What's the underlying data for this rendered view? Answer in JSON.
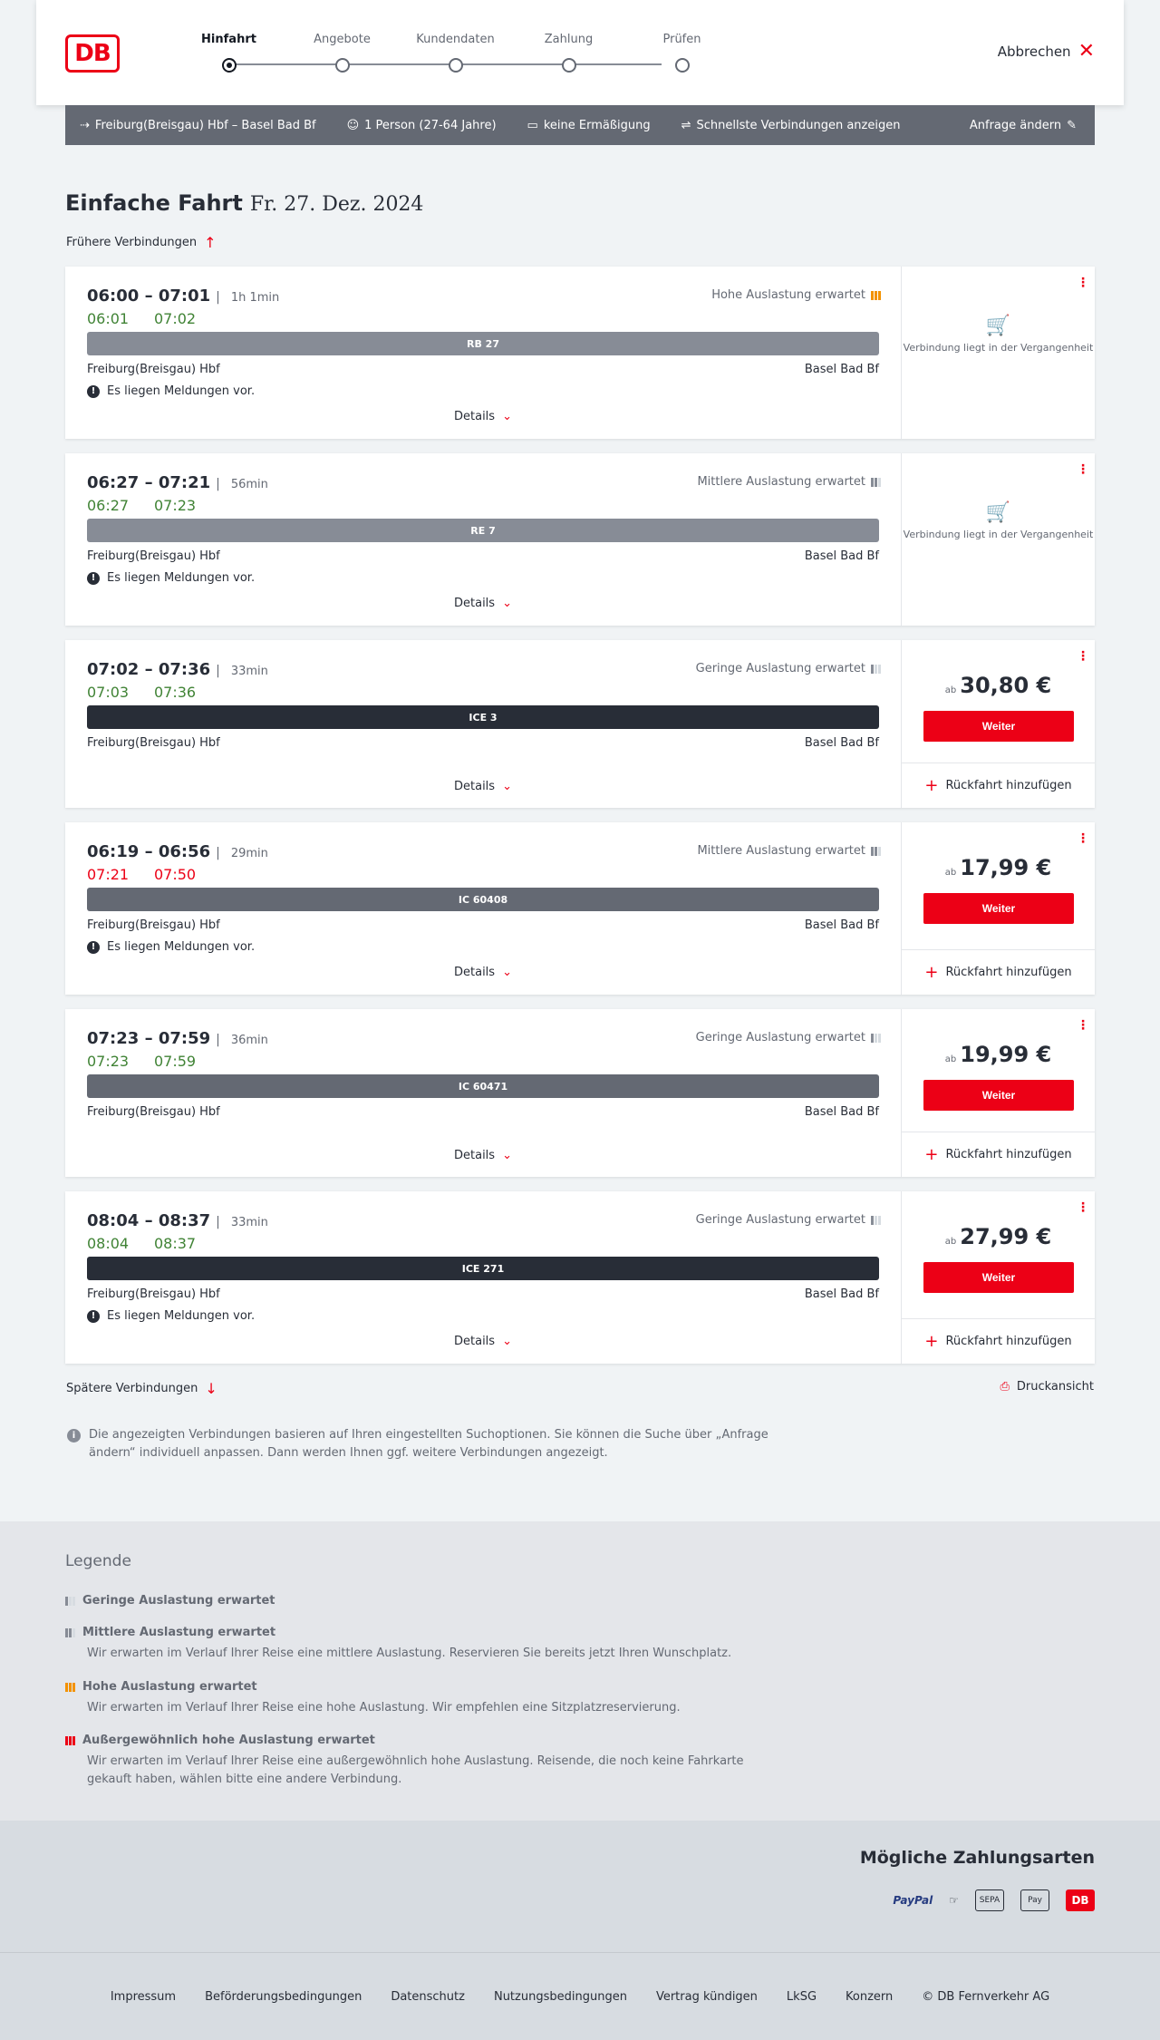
{
  "header": {
    "logo_text": "DB",
    "steps": [
      {
        "label": "Hinfahrt",
        "active": true
      },
      {
        "label": "Angebote",
        "active": false
      },
      {
        "label": "Kundendaten",
        "active": false
      },
      {
        "label": "Zahlung",
        "active": false
      },
      {
        "label": "Prüfen",
        "active": false
      }
    ],
    "cancel_label": "Abbrechen"
  },
  "query": {
    "route": "Freiburg(Breisgau) Hbf – Basel Bad Bf",
    "persons": "1 Person (27-64 Jahre)",
    "discount": "keine Ermäßigung",
    "fastest": "Schnellste Verbindungen anzeigen",
    "change": "Anfrage ändern"
  },
  "page": {
    "title": "Einfache Fahrt",
    "date": "Fr. 27. Dez. 2024",
    "earlier": "Frühere Verbindungen",
    "later": "Spätere Verbindungen",
    "print": "Druckansicht",
    "info": "Die angezeigten Verbindungen basieren auf Ihren eingestellten Suchoptionen. Sie können die Suche über „Anfrage ändern“ individuell anpassen. Dann werden Ihnen ggf. weitere Verbindungen angezeigt."
  },
  "labels": {
    "details": "Details",
    "weiter": "Weiter",
    "rueckfahrt": "Rückfahrt hinzufügen",
    "ab": "ab",
    "past": "Verbindung liegt in der Vergangenheit",
    "meldung": "Es liegen Meldungen vor.",
    "from": "Freiburg(Breisgau) Hbf",
    "to": "Basel Bad Bf"
  },
  "connections": [
    {
      "times": "06:00 – 07:01",
      "duration": "1h 1min",
      "rt_dep": "06:01",
      "rt_arr": "07:02",
      "rt_late": false,
      "load": "Hohe Auslastung erwartet",
      "load_level": 3,
      "train": "RB 27",
      "train_style": "light",
      "meldung": true,
      "past": true,
      "price": ""
    },
    {
      "times": "06:27 – 07:21",
      "duration": "56min",
      "rt_dep": "06:27",
      "rt_arr": "07:23",
      "rt_late": false,
      "load": "Mittlere Auslastung erwartet",
      "load_level": 2,
      "train": "RE 7",
      "train_style": "light",
      "meldung": true,
      "past": true,
      "price": ""
    },
    {
      "times": "07:02 – 07:36",
      "duration": "33min",
      "rt_dep": "07:03",
      "rt_arr": "07:36",
      "rt_late": false,
      "load": "Geringe Auslastung erwartet",
      "load_level": 1,
      "train": "ICE 3",
      "train_style": "dark",
      "meldung": false,
      "past": false,
      "price": "30,80 €"
    },
    {
      "times": "06:19 – 06:56",
      "duration": "29min",
      "rt_dep": "07:21",
      "rt_arr": "07:50",
      "rt_late": true,
      "load": "Mittlere Auslastung erwartet",
      "load_level": 2,
      "train": "IC 60408",
      "train_style": "mid",
      "meldung": true,
      "past": false,
      "price": "17,99 €"
    },
    {
      "times": "07:23 – 07:59",
      "duration": "36min",
      "rt_dep": "07:23",
      "rt_arr": "07:59",
      "rt_late": false,
      "load": "Geringe Auslastung erwartet",
      "load_level": 1,
      "train": "IC 60471",
      "train_style": "mid",
      "meldung": false,
      "past": false,
      "price": "19,99 €"
    },
    {
      "times": "08:04 – 08:37",
      "duration": "33min",
      "rt_dep": "08:04",
      "rt_arr": "08:37",
      "rt_late": false,
      "load": "Geringe Auslastung erwartet",
      "load_level": 1,
      "train": "ICE 271",
      "train_style": "dark",
      "meldung": true,
      "past": false,
      "price": "27,99 €"
    }
  ],
  "legend": {
    "title": "Legende",
    "items": [
      {
        "title": "Geringe Auslastung erwartet",
        "desc": "",
        "level": 1
      },
      {
        "title": "Mittlere Auslastung erwartet",
        "desc": "Wir erwarten im Verlauf Ihrer Reise eine mittlere Auslastung. Reservieren Sie bereits jetzt Ihren Wunschplatz.",
        "level": 2
      },
      {
        "title": "Hohe Auslastung erwartet",
        "desc": "Wir erwarten im Verlauf Ihrer Reise eine hohe Auslastung. Wir empfehlen eine Sitzplatzreservierung.",
        "level": 3
      },
      {
        "title": "Außergewöhnlich hohe Auslastung erwartet",
        "desc": "Wir erwarten im Verlauf Ihrer Reise eine außergewöhnlich hohe Auslastung. Reisende, die noch keine Fahrkarte gekauft haben, wählen bitte eine andere Verbindung.",
        "level": 4
      }
    ]
  },
  "payment": {
    "title": "Mögliche Zahlungsarten",
    "methods": [
      "PayPal",
      "Kreditkarte",
      "SEPA",
      "Pay",
      "DB"
    ]
  },
  "footer": {
    "links": [
      "Impressum",
      "Beförderungsbedingungen",
      "Datenschutz",
      "Nutzungsbedingungen",
      "Vertrag kündigen",
      "LkSG",
      "Konzern",
      "© DB Fernverkehr AG"
    ]
  }
}
